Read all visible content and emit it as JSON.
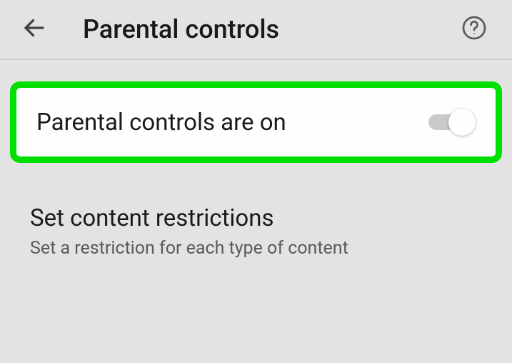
{
  "header": {
    "title": "Parental controls"
  },
  "toggle_row": {
    "label": "Parental controls are on",
    "state": "on"
  },
  "restrictions": {
    "title": "Set content restrictions",
    "subtitle": "Set a restriction for each type of content"
  }
}
